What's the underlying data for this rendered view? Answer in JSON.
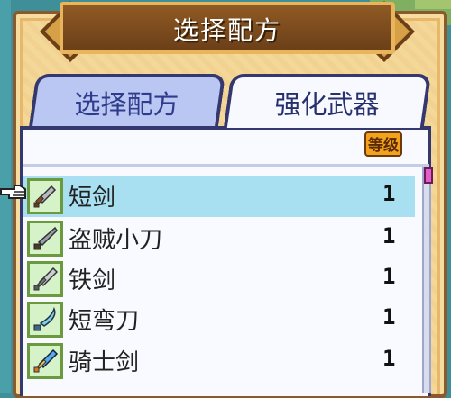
{
  "title": "选择配方",
  "tabs": [
    {
      "label": "选择配方"
    },
    {
      "label": "强化武器"
    }
  ],
  "level_header": "等级",
  "items": [
    {
      "name": "短剑",
      "level": "1",
      "icon": "short-sword-icon"
    },
    {
      "name": "盗贼小刀",
      "level": "1",
      "icon": "thief-knife-icon"
    },
    {
      "name": "铁剑",
      "level": "1",
      "icon": "iron-sword-icon"
    },
    {
      "name": "短弯刀",
      "level": "1",
      "icon": "scimitar-icon"
    },
    {
      "name": "骑士剑",
      "level": "1",
      "icon": "knight-sword-icon"
    }
  ],
  "selected_index": 0,
  "colors": {
    "frame": "#8a5a2e",
    "parchment": "#f6dc9e",
    "panel_border": "#34386e",
    "selected_row": "#a8dff1",
    "icon_bg": "#d6f2c9",
    "level_badge": "#f3a31b",
    "scroll_thumb": "#e060c8"
  }
}
